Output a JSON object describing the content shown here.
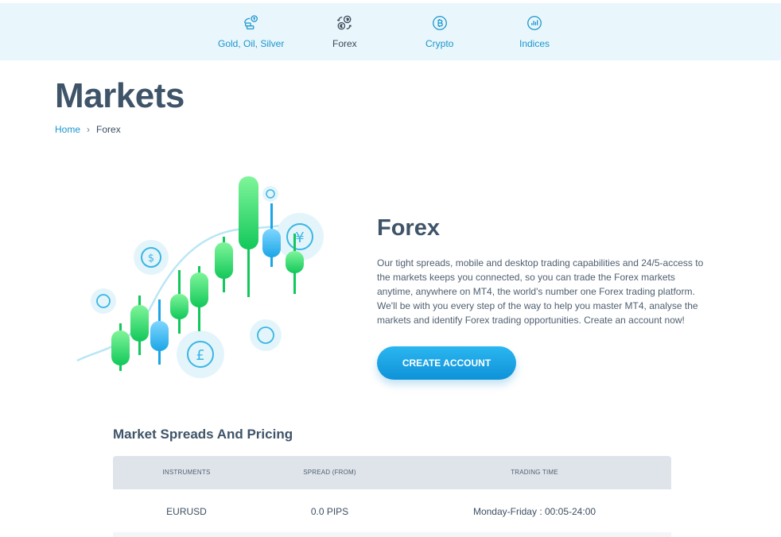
{
  "nav": {
    "items": [
      {
        "label": "Gold, Oil, Silver",
        "icon": "commodities-icon"
      },
      {
        "label": "Forex",
        "icon": "currency-exchange-icon"
      },
      {
        "label": "Crypto",
        "icon": "bitcoin-icon"
      },
      {
        "label": "Indices",
        "icon": "chart-bars-icon"
      }
    ],
    "active": "Forex"
  },
  "page": {
    "title": "Markets",
    "breadcrumb": {
      "home": "Home",
      "separator": "›",
      "current": "Forex"
    }
  },
  "hero": {
    "heading": "Forex",
    "body": "Our tight spreads, mobile and desktop trading capabilities and 24/5-access to the markets keeps you connected, so you can trade the Forex markets anytime, anywhere on MT4, the world's number one Forex trading platform. We'll be with you every step of the way to help you master MT4, analyse the markets and identify Forex trading opportunities. Create an account now!",
    "cta_label": "CREATE ACCOUNT"
  },
  "pricing": {
    "title": "Market Spreads And Pricing",
    "columns": [
      "INSTRUMENTS",
      "SPREAD (FROM)",
      "TRADING TIME"
    ],
    "rows": [
      {
        "instrument": "EURUSD",
        "spread": "0.0 PIPS",
        "time": "Monday-Friday : 00:05-24:00"
      }
    ]
  },
  "colors": {
    "accent": "#1a96cf",
    "nav_bg": "#e9f6fb",
    "heading": "#3f5469",
    "candle_green": "#1ed86a",
    "candle_blue": "#22aee8"
  }
}
